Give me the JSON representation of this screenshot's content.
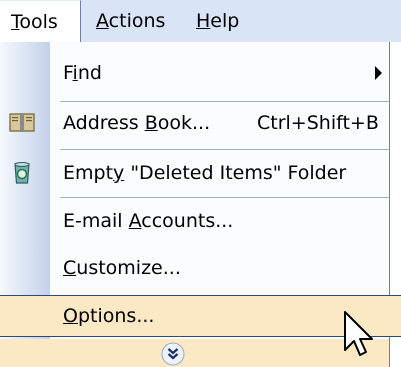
{
  "menubar": {
    "tools": "Tools",
    "actions": "Actions",
    "help": "Help"
  },
  "menu": {
    "items": [
      {
        "label_pre": "F",
        "label_ul": "i",
        "label_post": "nd",
        "has_submenu": true
      },
      {
        "label_pre": "Address ",
        "label_ul": "B",
        "label_post": "ook...",
        "shortcut": "Ctrl+Shift+B",
        "icon": "address-book-icon"
      },
      {
        "label_pre": "Empt",
        "label_ul": "y",
        "label_post": " \"Deleted Items\" Folder",
        "icon": "recycle-bin-icon"
      },
      {
        "label_pre": "E-mail ",
        "label_ul": "A",
        "label_post": "ccounts..."
      },
      {
        "label_pre": "",
        "label_ul": "C",
        "label_post": "ustomize..."
      },
      {
        "label_pre": "",
        "label_ul": "O",
        "label_post": "ptions...",
        "highlighted": true
      }
    ],
    "expand_icon": "double-chevron-down-icon"
  },
  "colors": {
    "menubar_bg": "#d9e5f7",
    "highlight_bg": "#fbe8c4",
    "highlight_border": "#2b4a7f",
    "gutter": "#c2d1ea"
  }
}
